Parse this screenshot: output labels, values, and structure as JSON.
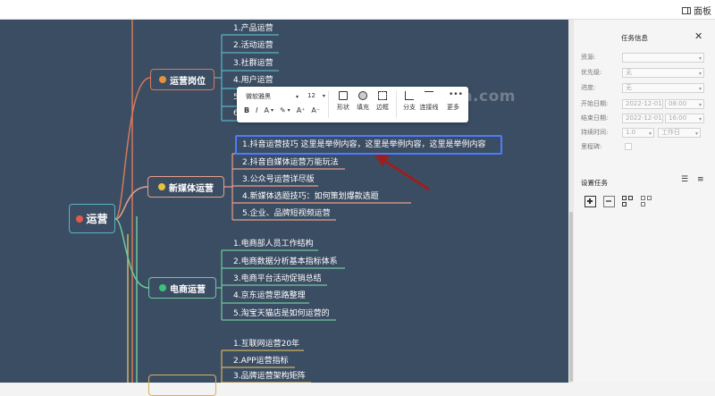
{
  "topbar": {
    "panel_label": "面板"
  },
  "watermark": "tuhuaba.com",
  "mindmap": {
    "root": "运营",
    "branches": [
      {
        "title": "运营岗位",
        "badge_color": "#e8913a",
        "items": [
          "1.产品运营",
          "2.活动运营",
          "3.社群运营",
          "4.用户运营",
          "5",
          "6"
        ]
      },
      {
        "title": "新媒体运营",
        "badge_color": "#e8c23a",
        "items": [
          "1.抖音运营技巧 这里是举例内容，这里是举例内容，这里是举例内容",
          "2.抖音自媒体运营万能玩法",
          "3.公众号运营详尽版",
          "4.新媒体选题技巧：如何策划爆款选题",
          "5.企业、品牌短视频运营"
        ]
      },
      {
        "title": "电商运营",
        "badge_color": "#3ac27a",
        "items": [
          "1.电商部人员工作结构",
          "2.电商数据分析基本指标体系",
          "3.电商平台活动促销总结",
          "4.京东运营思路整理",
          "5.淘宝天猫店是如何运营的"
        ]
      },
      {
        "title": "",
        "badge_color": "#d4b45a",
        "items": [
          "1.互联网运营20年",
          "2.APP运营指标",
          "3.品牌运营架构矩阵"
        ]
      }
    ]
  },
  "format_toolbar": {
    "font": "微软雅黑",
    "size": "12",
    "style_buttons": [
      "B",
      "I",
      "A",
      "A⁺",
      "A⁻"
    ],
    "tools": [
      "形状",
      "填充",
      "边框",
      "分支",
      "连接线",
      "更多"
    ]
  },
  "task_panel": {
    "title": "任务信息",
    "fields": [
      {
        "label": "资源:",
        "value": ""
      },
      {
        "label": "优先级:",
        "value": "无"
      },
      {
        "label": "进度:",
        "value": "无"
      },
      {
        "label": "开始日期:",
        "date": "2022-12-01",
        "time": "08:00"
      },
      {
        "label": "结束日期:",
        "date": "2022-12-01",
        "time": "16:00"
      },
      {
        "label": "持续时间:",
        "value": "1.0",
        "unit": "工作日"
      },
      {
        "label": "里程碑:"
      }
    ],
    "section_title": "设置任务"
  }
}
